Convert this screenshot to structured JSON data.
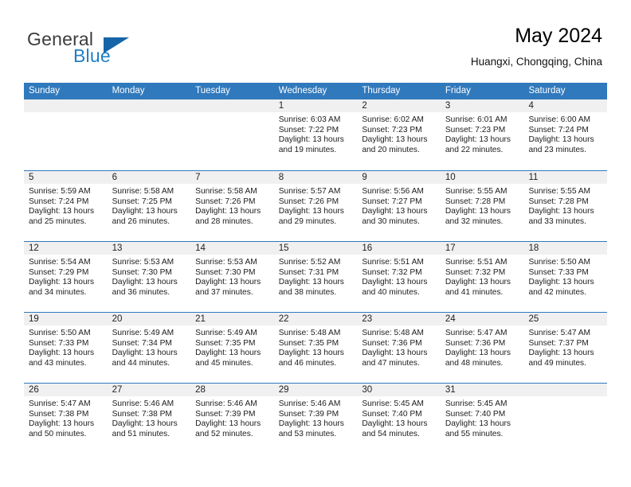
{
  "brand": {
    "name_part1": "General",
    "name_part2": "Blue",
    "triangle_color": "#1565a8",
    "blue_color": "#1f7fc6"
  },
  "header": {
    "title": "May 2024",
    "subtitle": "Huangxi, Chongqing, China"
  },
  "theme": {
    "header_blue": "#3079bd",
    "day_band_gray": "#f0f0f0"
  },
  "weekday_headers": [
    "Sunday",
    "Monday",
    "Tuesday",
    "Wednesday",
    "Thursday",
    "Friday",
    "Saturday"
  ],
  "labels": {
    "sunrise_prefix": "Sunrise:",
    "sunset_prefix": "Sunset:",
    "daylight_prefix": "Daylight:"
  },
  "weeks": [
    [
      {
        "day": "",
        "empty": true,
        "line1": "",
        "line2": "",
        "line3": "",
        "line4": ""
      },
      {
        "day": "",
        "empty": true,
        "line1": "",
        "line2": "",
        "line3": "",
        "line4": ""
      },
      {
        "day": "",
        "empty": true,
        "line1": "",
        "line2": "",
        "line3": "",
        "line4": ""
      },
      {
        "day": "1",
        "empty": false,
        "line1": "Sunrise: 6:03 AM",
        "line2": "Sunset: 7:22 PM",
        "line3": "Daylight: 13 hours",
        "line4": "and 19 minutes."
      },
      {
        "day": "2",
        "empty": false,
        "line1": "Sunrise: 6:02 AM",
        "line2": "Sunset: 7:23 PM",
        "line3": "Daylight: 13 hours",
        "line4": "and 20 minutes."
      },
      {
        "day": "3",
        "empty": false,
        "line1": "Sunrise: 6:01 AM",
        "line2": "Sunset: 7:23 PM",
        "line3": "Daylight: 13 hours",
        "line4": "and 22 minutes."
      },
      {
        "day": "4",
        "empty": false,
        "line1": "Sunrise: 6:00 AM",
        "line2": "Sunset: 7:24 PM",
        "line3": "Daylight: 13 hours",
        "line4": "and 23 minutes."
      }
    ],
    [
      {
        "day": "5",
        "empty": false,
        "line1": "Sunrise: 5:59 AM",
        "line2": "Sunset: 7:24 PM",
        "line3": "Daylight: 13 hours",
        "line4": "and 25 minutes."
      },
      {
        "day": "6",
        "empty": false,
        "line1": "Sunrise: 5:58 AM",
        "line2": "Sunset: 7:25 PM",
        "line3": "Daylight: 13 hours",
        "line4": "and 26 minutes."
      },
      {
        "day": "7",
        "empty": false,
        "line1": "Sunrise: 5:58 AM",
        "line2": "Sunset: 7:26 PM",
        "line3": "Daylight: 13 hours",
        "line4": "and 28 minutes."
      },
      {
        "day": "8",
        "empty": false,
        "line1": "Sunrise: 5:57 AM",
        "line2": "Sunset: 7:26 PM",
        "line3": "Daylight: 13 hours",
        "line4": "and 29 minutes."
      },
      {
        "day": "9",
        "empty": false,
        "line1": "Sunrise: 5:56 AM",
        "line2": "Sunset: 7:27 PM",
        "line3": "Daylight: 13 hours",
        "line4": "and 30 minutes."
      },
      {
        "day": "10",
        "empty": false,
        "line1": "Sunrise: 5:55 AM",
        "line2": "Sunset: 7:28 PM",
        "line3": "Daylight: 13 hours",
        "line4": "and 32 minutes."
      },
      {
        "day": "11",
        "empty": false,
        "line1": "Sunrise: 5:55 AM",
        "line2": "Sunset: 7:28 PM",
        "line3": "Daylight: 13 hours",
        "line4": "and 33 minutes."
      }
    ],
    [
      {
        "day": "12",
        "empty": false,
        "line1": "Sunrise: 5:54 AM",
        "line2": "Sunset: 7:29 PM",
        "line3": "Daylight: 13 hours",
        "line4": "and 34 minutes."
      },
      {
        "day": "13",
        "empty": false,
        "line1": "Sunrise: 5:53 AM",
        "line2": "Sunset: 7:30 PM",
        "line3": "Daylight: 13 hours",
        "line4": "and 36 minutes."
      },
      {
        "day": "14",
        "empty": false,
        "line1": "Sunrise: 5:53 AM",
        "line2": "Sunset: 7:30 PM",
        "line3": "Daylight: 13 hours",
        "line4": "and 37 minutes."
      },
      {
        "day": "15",
        "empty": false,
        "line1": "Sunrise: 5:52 AM",
        "line2": "Sunset: 7:31 PM",
        "line3": "Daylight: 13 hours",
        "line4": "and 38 minutes."
      },
      {
        "day": "16",
        "empty": false,
        "line1": "Sunrise: 5:51 AM",
        "line2": "Sunset: 7:32 PM",
        "line3": "Daylight: 13 hours",
        "line4": "and 40 minutes."
      },
      {
        "day": "17",
        "empty": false,
        "line1": "Sunrise: 5:51 AM",
        "line2": "Sunset: 7:32 PM",
        "line3": "Daylight: 13 hours",
        "line4": "and 41 minutes."
      },
      {
        "day": "18",
        "empty": false,
        "line1": "Sunrise: 5:50 AM",
        "line2": "Sunset: 7:33 PM",
        "line3": "Daylight: 13 hours",
        "line4": "and 42 minutes."
      }
    ],
    [
      {
        "day": "19",
        "empty": false,
        "line1": "Sunrise: 5:50 AM",
        "line2": "Sunset: 7:33 PM",
        "line3": "Daylight: 13 hours",
        "line4": "and 43 minutes."
      },
      {
        "day": "20",
        "empty": false,
        "line1": "Sunrise: 5:49 AM",
        "line2": "Sunset: 7:34 PM",
        "line3": "Daylight: 13 hours",
        "line4": "and 44 minutes."
      },
      {
        "day": "21",
        "empty": false,
        "line1": "Sunrise: 5:49 AM",
        "line2": "Sunset: 7:35 PM",
        "line3": "Daylight: 13 hours",
        "line4": "and 45 minutes."
      },
      {
        "day": "22",
        "empty": false,
        "line1": "Sunrise: 5:48 AM",
        "line2": "Sunset: 7:35 PM",
        "line3": "Daylight: 13 hours",
        "line4": "and 46 minutes."
      },
      {
        "day": "23",
        "empty": false,
        "line1": "Sunrise: 5:48 AM",
        "line2": "Sunset: 7:36 PM",
        "line3": "Daylight: 13 hours",
        "line4": "and 47 minutes."
      },
      {
        "day": "24",
        "empty": false,
        "line1": "Sunrise: 5:47 AM",
        "line2": "Sunset: 7:36 PM",
        "line3": "Daylight: 13 hours",
        "line4": "and 48 minutes."
      },
      {
        "day": "25",
        "empty": false,
        "line1": "Sunrise: 5:47 AM",
        "line2": "Sunset: 7:37 PM",
        "line3": "Daylight: 13 hours",
        "line4": "and 49 minutes."
      }
    ],
    [
      {
        "day": "26",
        "empty": false,
        "line1": "Sunrise: 5:47 AM",
        "line2": "Sunset: 7:38 PM",
        "line3": "Daylight: 13 hours",
        "line4": "and 50 minutes."
      },
      {
        "day": "27",
        "empty": false,
        "line1": "Sunrise: 5:46 AM",
        "line2": "Sunset: 7:38 PM",
        "line3": "Daylight: 13 hours",
        "line4": "and 51 minutes."
      },
      {
        "day": "28",
        "empty": false,
        "line1": "Sunrise: 5:46 AM",
        "line2": "Sunset: 7:39 PM",
        "line3": "Daylight: 13 hours",
        "line4": "and 52 minutes."
      },
      {
        "day": "29",
        "empty": false,
        "line1": "Sunrise: 5:46 AM",
        "line2": "Sunset: 7:39 PM",
        "line3": "Daylight: 13 hours",
        "line4": "and 53 minutes."
      },
      {
        "day": "30",
        "empty": false,
        "line1": "Sunrise: 5:45 AM",
        "line2": "Sunset: 7:40 PM",
        "line3": "Daylight: 13 hours",
        "line4": "and 54 minutes."
      },
      {
        "day": "31",
        "empty": false,
        "line1": "Sunrise: 5:45 AM",
        "line2": "Sunset: 7:40 PM",
        "line3": "Daylight: 13 hours",
        "line4": "and 55 minutes."
      },
      {
        "day": "",
        "empty": true,
        "line1": "",
        "line2": "",
        "line3": "",
        "line4": ""
      }
    ]
  ]
}
